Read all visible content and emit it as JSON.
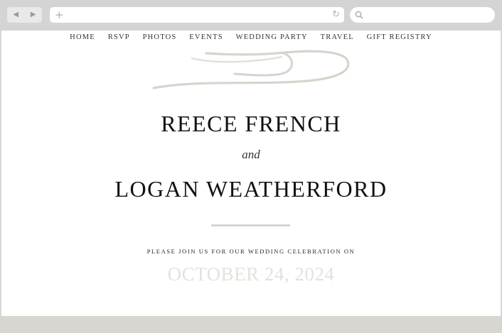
{
  "browser": {
    "back_glyph": "◀",
    "forward_glyph": "▶",
    "new_tab_glyph": "+",
    "reload_glyph": "↻",
    "address_value": "",
    "search_value": ""
  },
  "nav": {
    "items": [
      "HOME",
      "RSVP",
      "PHOTOS",
      "EVENTS",
      "WEDDING PARTY",
      "TRAVEL",
      "GIFT REGISTRY"
    ]
  },
  "hero": {
    "name_one": "REECE FRENCH",
    "conjunction": "and",
    "name_two": "LOGAN WEATHERFORD",
    "invitation": "PLEASE JOIN US FOR OUR WEDDING CELEBRATION ON",
    "date": "OCTOBER 24, 2024"
  },
  "colors": {
    "chrome": "#d4d4d4",
    "flourish": "#d6d4cc",
    "date_text": "#e5e2dc",
    "footer": "#d9d6d2"
  }
}
